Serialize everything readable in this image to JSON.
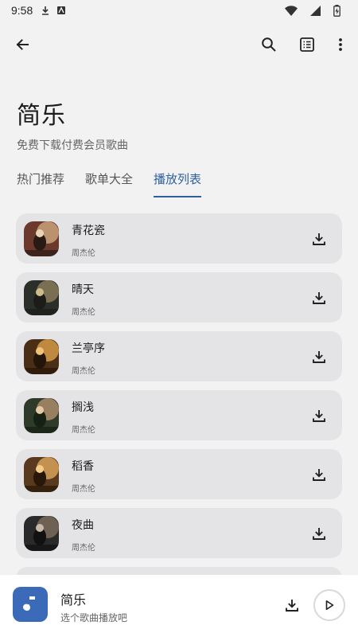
{
  "status_bar": {
    "time": "9:58"
  },
  "header": {
    "title": "简乐",
    "subtitle": "免费下载付费会员歌曲"
  },
  "tabs": [
    {
      "label": "热门推荐",
      "active": false
    },
    {
      "label": "歌单大全",
      "active": false
    },
    {
      "label": "播放列表",
      "active": true
    }
  ],
  "songs": [
    {
      "title": "青花瓷",
      "artist": "周杰伦",
      "cover_icon": "album-cover"
    },
    {
      "title": "晴天",
      "artist": "周杰伦",
      "cover_icon": "album-cover"
    },
    {
      "title": "兰亭序",
      "artist": "周杰伦",
      "cover_icon": "album-cover"
    },
    {
      "title": "搁浅",
      "artist": "周杰伦",
      "cover_icon": "album-cover"
    },
    {
      "title": "稻香",
      "artist": "周杰伦",
      "cover_icon": "album-cover"
    },
    {
      "title": "夜曲",
      "artist": "周杰伦",
      "cover_icon": "album-cover"
    }
  ],
  "player": {
    "title": "简乐",
    "subtitle": "选个歌曲播放吧"
  },
  "colors": {
    "accent": "#2e5fa3",
    "card": "#e4e4e6",
    "background": "#f2f2f2",
    "player_art": "#3a6ab8"
  }
}
